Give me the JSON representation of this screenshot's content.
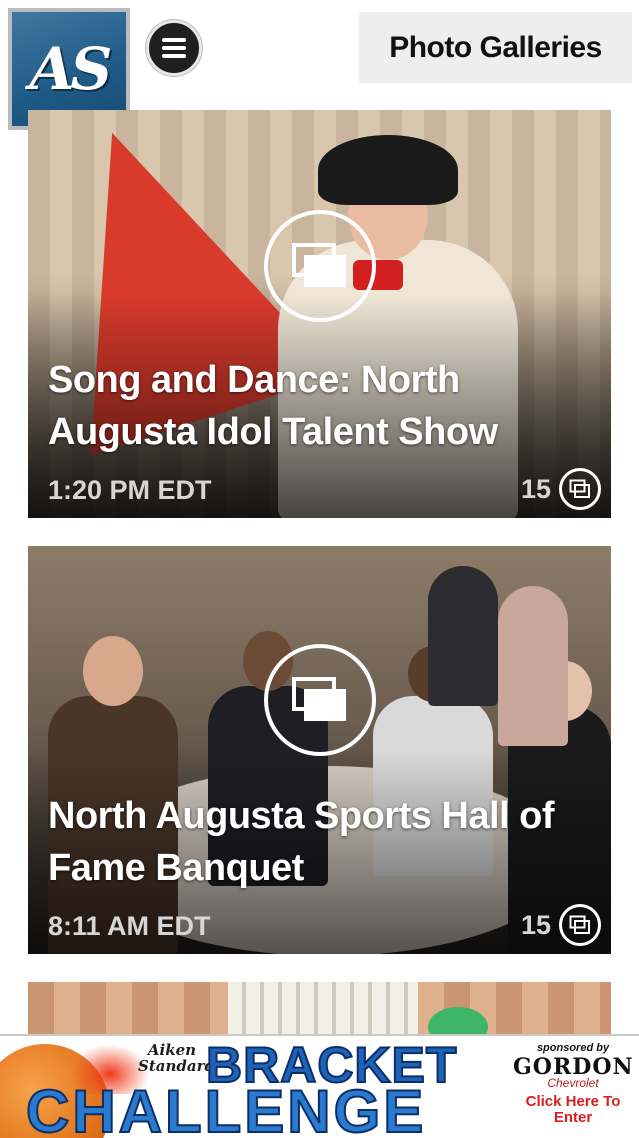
{
  "header": {
    "logo_text": "AS",
    "section_button_label": "Photo Galleries",
    "menu_icon": "hamburger-icon"
  },
  "galleries": [
    {
      "title": "Song and Dance: North Augusta Idol Talent Show",
      "time": "1:20 PM EDT",
      "count": "15",
      "icon": "gallery-icon"
    },
    {
      "title": "North Augusta Sports Hall of Fame Banquet",
      "time": "8:11 AM EDT",
      "count": "15",
      "icon": "gallery-icon"
    }
  ],
  "ad": {
    "paper_name": "Aiken Standard",
    "headline_1": "BRACKET",
    "headline_2": "CHALLENGE",
    "sponsored_by": "sponsored by",
    "sponsor_brand": "GORDON",
    "sponsor_sub": "Chevrolet",
    "cta": "Click Here To Enter"
  },
  "colors": {
    "logo_blue": "#1e5a86",
    "ad_blue": "#1e63b8",
    "ad_red": "#d61f1f"
  }
}
